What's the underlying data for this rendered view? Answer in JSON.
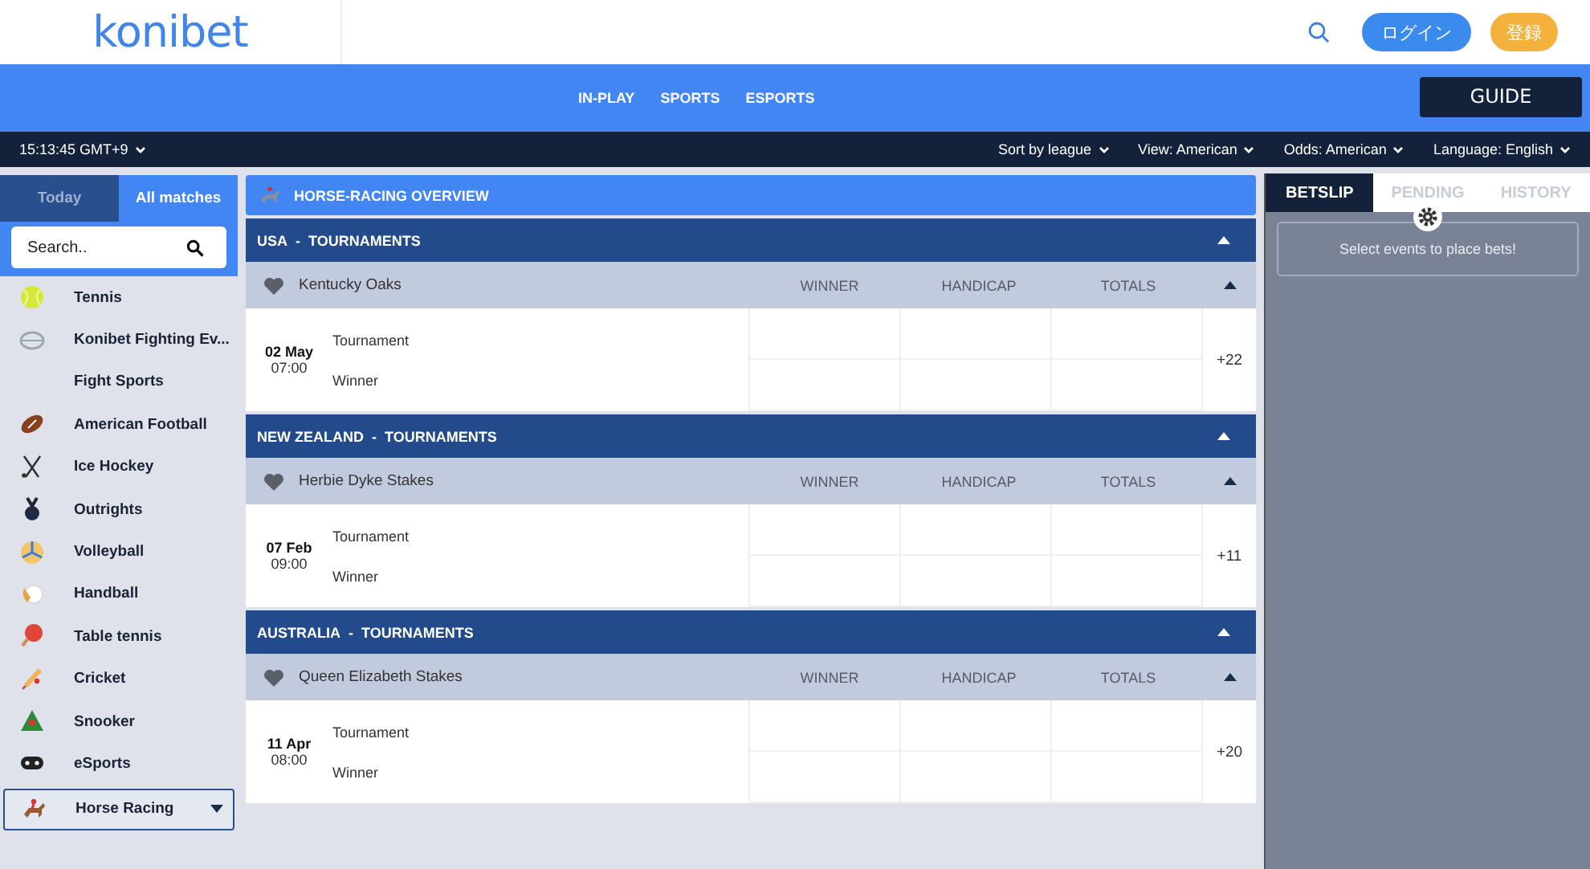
{
  "header": {
    "logo": "konibet",
    "login": "ログイン",
    "register": "登録"
  },
  "nav": {
    "links": [
      "IN-PLAY",
      "SPORTS",
      "ESPORTS"
    ],
    "guide": "GUIDE"
  },
  "toolbar": {
    "clock": "15:13:45 GMT+9",
    "filters": [
      "Sort by league",
      "View: American",
      "Odds: American",
      "Language: English"
    ]
  },
  "sidebar": {
    "tabs": [
      {
        "label": "Today",
        "selected": false
      },
      {
        "label": "All matches",
        "selected": true
      }
    ],
    "search": {
      "placeholder": "Search.."
    },
    "sports": [
      {
        "label": "Tennis",
        "selected": false
      },
      {
        "label": "Konibet Fighting Ev...",
        "selected": false
      },
      {
        "label": "Fight Sports",
        "selected": false
      },
      {
        "label": "American Football",
        "selected": false
      },
      {
        "label": "Ice Hockey",
        "selected": false
      },
      {
        "label": "Outrights",
        "selected": false
      },
      {
        "label": "Volleyball",
        "selected": false
      },
      {
        "label": "Handball",
        "selected": false
      },
      {
        "label": "Table tennis",
        "selected": false
      },
      {
        "label": "Cricket",
        "selected": false
      },
      {
        "label": "Snooker",
        "selected": false
      },
      {
        "label": "eSports",
        "selected": false
      },
      {
        "label": "Horse Racing",
        "selected": true
      }
    ]
  },
  "overview": {
    "title": "HORSE-RACING OVERVIEW"
  },
  "sections": [
    {
      "region": "USA",
      "sep": "-",
      "group": "TOURNAMENTS",
      "event": "Kentucky Oaks",
      "columns": [
        "WINNER",
        "HANDICAP",
        "TOTALS"
      ],
      "date": "02 May",
      "time": "07:00",
      "lines": [
        "Tournament",
        "Winner"
      ],
      "more": "+22"
    },
    {
      "region": "NEW ZEALAND",
      "sep": "-",
      "group": "TOURNAMENTS",
      "event": "Herbie Dyke Stakes",
      "columns": [
        "WINNER",
        "HANDICAP",
        "TOTALS"
      ],
      "date": "07 Feb",
      "time": "09:00",
      "lines": [
        "Tournament",
        "Winner"
      ],
      "more": "+11"
    },
    {
      "region": "AUSTRALIA",
      "sep": "-",
      "group": "TOURNAMENTS",
      "event": "Queen Elizabeth Stakes",
      "columns": [
        "WINNER",
        "HANDICAP",
        "TOTALS"
      ],
      "date": "11 Apr",
      "time": "08:00",
      "lines": [
        "Tournament",
        "Winner"
      ],
      "more": "+20"
    }
  ],
  "betslip": {
    "tabs": [
      {
        "label": "BETSLIP",
        "selected": true
      },
      {
        "label": "PENDING",
        "selected": false
      },
      {
        "label": "HISTORY",
        "selected": false
      }
    ],
    "message": "Select events to place bets!"
  }
}
